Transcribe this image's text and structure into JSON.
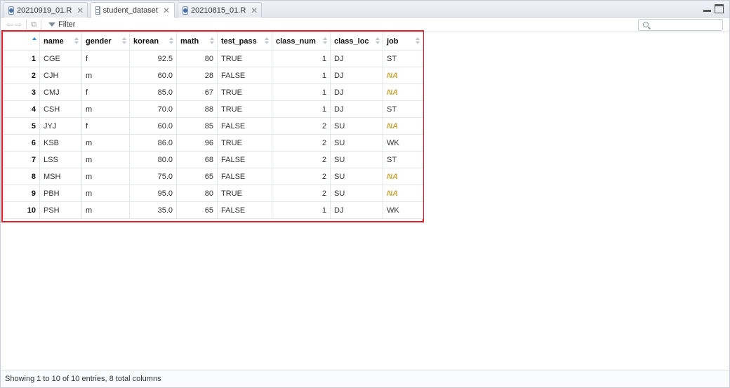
{
  "tabs": [
    {
      "label": "20210919_01.R",
      "icon": "r-script-icon",
      "active": false
    },
    {
      "label": "student_dataset",
      "icon": "data-grid-icon",
      "active": true
    },
    {
      "label": "20210815_01.R",
      "icon": "r-script-icon",
      "active": false
    }
  ],
  "toolbar": {
    "filter_label": "Filter",
    "search_placeholder": ""
  },
  "table": {
    "columns": [
      "name",
      "gender",
      "korean",
      "math",
      "test_pass",
      "class_num",
      "class_loc",
      "job"
    ],
    "rows": [
      {
        "n": "1",
        "cells": [
          "CGE",
          "f",
          "92.5",
          "80",
          "TRUE",
          "1",
          "DJ",
          "ST"
        ]
      },
      {
        "n": "2",
        "cells": [
          "CJH",
          "m",
          "60.0",
          "28",
          "FALSE",
          "1",
          "DJ",
          "NA"
        ]
      },
      {
        "n": "3",
        "cells": [
          "CMJ",
          "f",
          "85.0",
          "67",
          "TRUE",
          "1",
          "DJ",
          "NA"
        ]
      },
      {
        "n": "4",
        "cells": [
          "CSH",
          "m",
          "70.0",
          "88",
          "TRUE",
          "1",
          "DJ",
          "ST"
        ]
      },
      {
        "n": "5",
        "cells": [
          "JYJ",
          "f",
          "60.0",
          "85",
          "FALSE",
          "2",
          "SU",
          "NA"
        ]
      },
      {
        "n": "6",
        "cells": [
          "KSB",
          "m",
          "86.0",
          "96",
          "TRUE",
          "2",
          "SU",
          "WK"
        ]
      },
      {
        "n": "7",
        "cells": [
          "LSS",
          "m",
          "80.0",
          "68",
          "FALSE",
          "2",
          "SU",
          "ST"
        ]
      },
      {
        "n": "8",
        "cells": [
          "MSH",
          "m",
          "75.0",
          "65",
          "FALSE",
          "2",
          "SU",
          "NA"
        ]
      },
      {
        "n": "9",
        "cells": [
          "PBH",
          "m",
          "95.0",
          "80",
          "TRUE",
          "2",
          "SU",
          "NA"
        ]
      },
      {
        "n": "10",
        "cells": [
          "PSH",
          "m",
          "35.0",
          "65",
          "FALSE",
          "1",
          "DJ",
          "WK"
        ]
      }
    ]
  },
  "status": {
    "text": "Showing 1 to 10 of 10 entries, 8 total columns"
  },
  "colors": {
    "highlight_border": "#e0212b",
    "na_text": "#c9a53d",
    "sort_accent": "#2a8fd8"
  }
}
